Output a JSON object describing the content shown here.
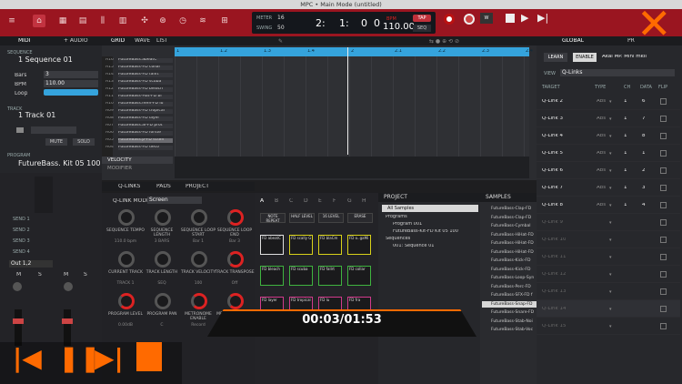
{
  "window": {
    "title": "MPC • Main Mode (untitled)"
  },
  "transport": {
    "meter_label": "METER",
    "meter_value": "16",
    "swing_label": "SWING",
    "swing_value": "50",
    "position": [
      "2:",
      "1:",
      "0",
      "0"
    ],
    "tempo_label": "BPM",
    "tempo": "110.00",
    "tap_label": "TAP",
    "seq_label": "SEQ"
  },
  "sequence": {
    "section_label": "SEQUENCE",
    "name": "1 Sequence 01",
    "bars_label": "Bars",
    "bars": "3",
    "bpm_label": "BPM",
    "bpm": "110.00",
    "loop_label": "Loop"
  },
  "track": {
    "section_label": "TRACK",
    "name": "1 Track 01",
    "mute_label": "MUTE",
    "solo_label": "SOLO"
  },
  "program": {
    "section_label": "PROGRAM",
    "name": "FutureBass. Kit 05 100"
  },
  "left_tabs": {
    "midi": "MIDI",
    "audio": "+ AUDIO"
  },
  "editor_tabs": [
    "GRID",
    "WAVE",
    "LIST"
  ],
  "ruler": [
    "1",
    "1.2",
    "1.3",
    "1.4",
    "2",
    "2.1",
    "2.2",
    "2.3",
    "2.4"
  ],
  "grid_tracks": [
    {
      "pad": "A16",
      "name": "FutureBass.abeatC"
    },
    {
      "pad": "A15",
      "name": "FutureBass-FD collar"
    },
    {
      "pad": "A14",
      "name": "FutureBass-FD fallrt"
    },
    {
      "pad": "A13",
      "name": "FutureBass-FD scuba"
    },
    {
      "pad": "A12",
      "name": "FutureBass-FD bleach"
    },
    {
      "pad": "A11",
      "name": "FutureBass-Hat-FD bi"
    },
    {
      "pad": "A10",
      "name": "FutureBass.hem-FD lu"
    },
    {
      "pad": "A09",
      "name": "FutureBass-FD tropical"
    },
    {
      "pad": "A08",
      "name": "FutureBass-FD layer"
    },
    {
      "pad": "A07",
      "name": "FutureBass.al-FD prot"
    },
    {
      "pad": "A06",
      "name": "FutureBass-FD forste"
    },
    {
      "pad": "A05",
      "name": "FutureBass.p-FD scdm"
    },
    {
      "pad": "A04",
      "name": "FutureBass-FD deco"
    }
  ],
  "velocity_label": "VELOCITY",
  "modifier_label": "MODIFIER",
  "sends": [
    "SEND 1",
    "SEND 2",
    "SEND 3",
    "SEND 4"
  ],
  "output": "Out 1,2",
  "mixer_buttons": [
    "M",
    "S",
    "M",
    "S"
  ],
  "bottom_tabs": {
    "qlinks": "Q-LINKS",
    "pads": "PADS",
    "project": "PROJECT"
  },
  "qlink_mode": {
    "label": "Q-LINK MODE:",
    "value": "Screen"
  },
  "knobs": [
    {
      "label": "SEQUENCE TEMPO",
      "value": "110.0 bpm"
    },
    {
      "label": "SEQUENCE LENGTH",
      "value": "3 BARS"
    },
    {
      "label": "SEQUENCE LOOP START",
      "value": "Bar 1"
    },
    {
      "label": "SEQUENCE LOOP END",
      "value": "Bar 3"
    },
    {
      "label": "CURRENT TRACK",
      "value": "TRACK 1"
    },
    {
      "label": "TRACK LENGTH",
      "value": "SEQ"
    },
    {
      "label": "TRACK VELOCITY",
      "value": "100"
    },
    {
      "label": "TRACK TRANSPOSE",
      "value": "Off"
    },
    {
      "label": "PROGRAM LEVEL",
      "value": "0.00dB"
    },
    {
      "label": "PROGRAM PAN",
      "value": "C"
    },
    {
      "label": "METRONOME ENABLE",
      "value": "Record"
    },
    {
      "label": "METRONOME LEV",
      "value": ""
    }
  ],
  "pad_banks": [
    "A",
    "B",
    "C",
    "D",
    "E",
    "F",
    "G",
    "H"
  ],
  "pad_buttons": [
    "NOTE REPEAT",
    "HALF LEVEL",
    "16 LEVEL",
    "ERASE"
  ],
  "pads": [
    {
      "name": "FD abeatC",
      "color": "#e0e0e0"
    },
    {
      "name": "FD scally G",
      "color": "#d9d21a"
    },
    {
      "name": "FD blaCm",
      "color": "#d9d21a"
    },
    {
      "name": "FD o..gaMi",
      "color": "#d9d21a"
    },
    {
      "name": "FD bleach",
      "color": "#3fb43f"
    },
    {
      "name": "FD scuba",
      "color": "#3fb43f"
    },
    {
      "name": "FD fallrt",
      "color": "#3fb43f"
    },
    {
      "name": "FD collar",
      "color": "#3fb43f"
    },
    {
      "name": "FD layer",
      "color": "#d23a8c"
    },
    {
      "name": "FD tropical",
      "color": "#d23a8c"
    },
    {
      "name": "FD lu",
      "color": "#d23a8c"
    },
    {
      "name": "FD fra",
      "color": "#d23a8c"
    }
  ],
  "project": {
    "header": "PROJECT",
    "items": [
      "All Samples",
      "Programs",
      "Program 001",
      "FutureBass-Kit-FD Kit 05 100",
      "Sequences",
      "001: Sequence 01"
    ]
  },
  "samples": {
    "header": "SAMPLES",
    "items": [
      "FutureBass-Clap-FD",
      "FutureBass-Clap-FD",
      "FutureBass-Cymbal",
      "FutureBass-HiHat-FD",
      "FutureBass-HiHat-FD",
      "FutureBass-HiHat-FD",
      "FutureBass-Kick-FD",
      "FutureBass-Kick-FD",
      "FutureBass-Loop-Syn",
      "FutureBass-Perc-FD",
      "FutureBass-SFX-FD f",
      "FutureBass-Snap-FD",
      "FutureBass-Snare-FD",
      "FutureBass-Stab-Noi",
      "FutureBass-Stab-Voc"
    ]
  },
  "global": {
    "tab": "GLOBAL",
    "tab2": "PR",
    "learn": "LEARN",
    "enable": "ENABLE",
    "device": "Akai MP. Mini mkII",
    "view_label": "VIEW",
    "view_value": "Q-Links",
    "columns": [
      "TARGET",
      "TYPE",
      "CH",
      "DATA",
      "FLIP"
    ],
    "rows": [
      {
        "target": "Q-Link 2",
        "type": "Abs",
        "ch": "1",
        "data": "6",
        "active": true
      },
      {
        "target": "Q-Link 3",
        "type": "Abs",
        "ch": "1",
        "data": "7",
        "active": true
      },
      {
        "target": "Q-Link 4",
        "type": "Abs",
        "ch": "1",
        "data": "8",
        "active": true
      },
      {
        "target": "Q-Link 5",
        "type": "Abs",
        "ch": "1",
        "data": "1",
        "active": true
      },
      {
        "target": "Q-Link 6",
        "type": "Abs",
        "ch": "1",
        "data": "2",
        "active": true
      },
      {
        "target": "Q-Link 7",
        "type": "Abs",
        "ch": "1",
        "data": "3",
        "active": true
      },
      {
        "target": "Q-Link 8",
        "type": "Abs",
        "ch": "1",
        "data": "4",
        "active": true
      },
      {
        "target": "Q-Link 9",
        "type": "",
        "ch": "",
        "data": "",
        "active": false
      },
      {
        "target": "Q-Link 10",
        "type": "",
        "ch": "",
        "data": "",
        "active": false
      },
      {
        "target": "Q-Link 11",
        "type": "",
        "ch": "",
        "data": "",
        "active": false
      },
      {
        "target": "Q-Link 12",
        "type": "",
        "ch": "",
        "data": "",
        "active": false
      },
      {
        "target": "Q-Link 13",
        "type": "",
        "ch": "",
        "data": "",
        "active": false
      },
      {
        "target": "Q-Link 14",
        "type": "",
        "ch": "",
        "data": "",
        "active": false
      },
      {
        "target": "Q-Link 15",
        "type": "",
        "ch": "",
        "data": "",
        "active": false
      }
    ]
  },
  "video": {
    "time": "00:03/01:53"
  },
  "colors": {
    "accent": "#ff6a00",
    "toolbar": "#9a1520",
    "loop": "#35a3dc"
  }
}
